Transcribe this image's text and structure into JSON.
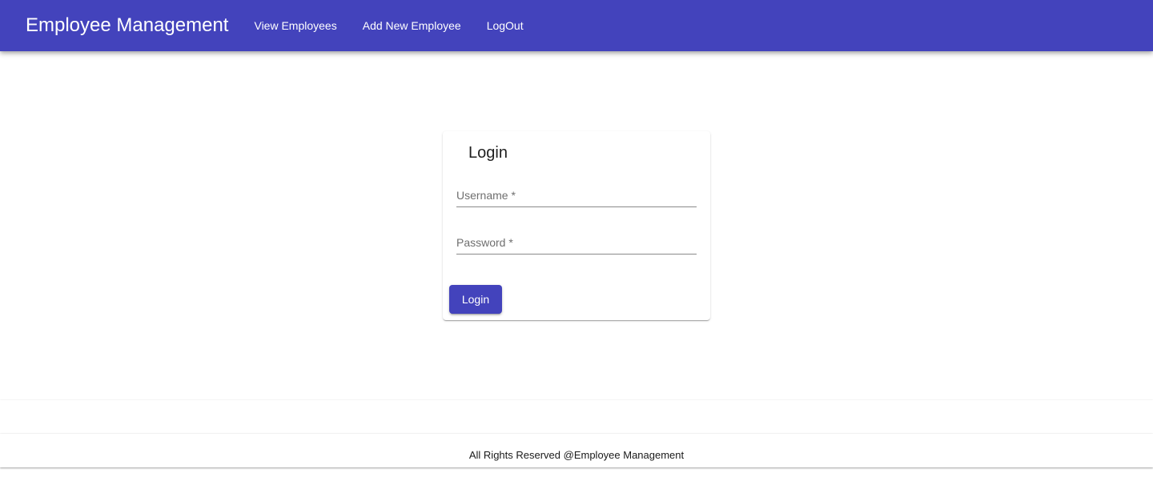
{
  "header": {
    "title": "Employee Management",
    "nav": [
      {
        "label": "View Employees"
      },
      {
        "label": "Add New Employee"
      },
      {
        "label": "LogOut"
      }
    ],
    "color": "#4343bc"
  },
  "login_card": {
    "title": "Login",
    "username": {
      "value": "",
      "placeholder": "Username *"
    },
    "password": {
      "value": "",
      "placeholder": "Password *"
    },
    "submit_label": "Login"
  },
  "footer": {
    "text": "All Rights Reserved @Employee Management"
  }
}
